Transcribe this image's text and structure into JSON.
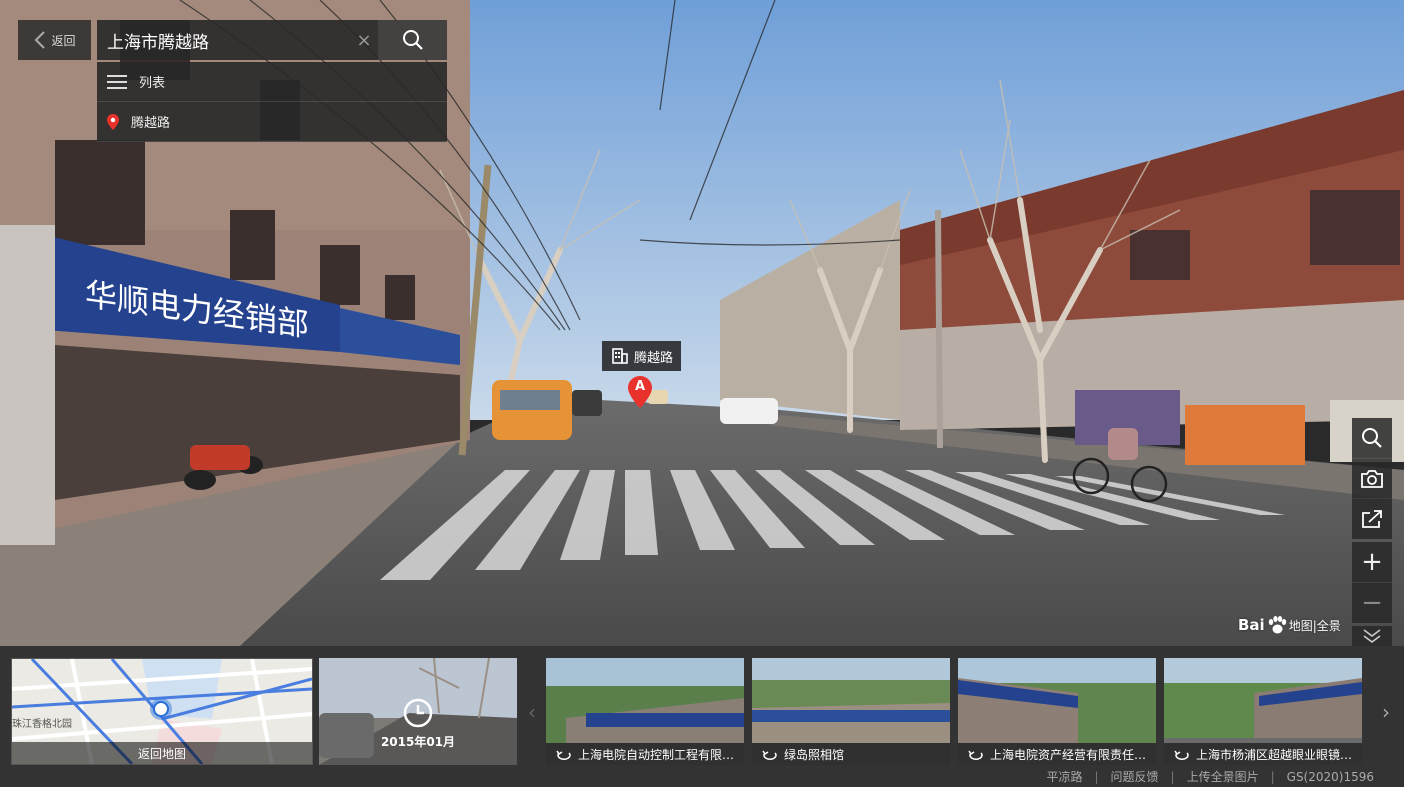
{
  "search": {
    "back_label": "返回",
    "query": "上海市腾越路",
    "results_header": "列表",
    "result_item": "腾越路"
  },
  "poi": {
    "label": "腾越路",
    "marker": "A"
  },
  "toolbar": {
    "tools": [
      "search-icon",
      "camera-icon",
      "share-icon",
      "zoom-in-icon",
      "zoom-out-icon",
      "collapse-icon"
    ]
  },
  "branding": {
    "logo_main": "Bai",
    "logo_sub": "地图|全景"
  },
  "filmstrip": {
    "map_caption": "返回地图",
    "map_street_label": "珠江香格北园",
    "time_label": "2015年01月",
    "scenes": [
      {
        "caption": "上海电院自动控制工程有限…"
      },
      {
        "caption": "绿岛照相馆"
      },
      {
        "caption": "上海电院资产经营有限责任…"
      },
      {
        "caption": "上海市杨浦区超越眼业眼镜…"
      }
    ]
  },
  "footer": {
    "street": "平凉路",
    "feedback": "问题反馈",
    "upload": "上传全景图片",
    "license": "GS(2020)1596"
  },
  "colors": {
    "marker_red": "#e8322b",
    "panel_bg": "#2d2d2d",
    "accent_blue": "#2a6fd6"
  }
}
